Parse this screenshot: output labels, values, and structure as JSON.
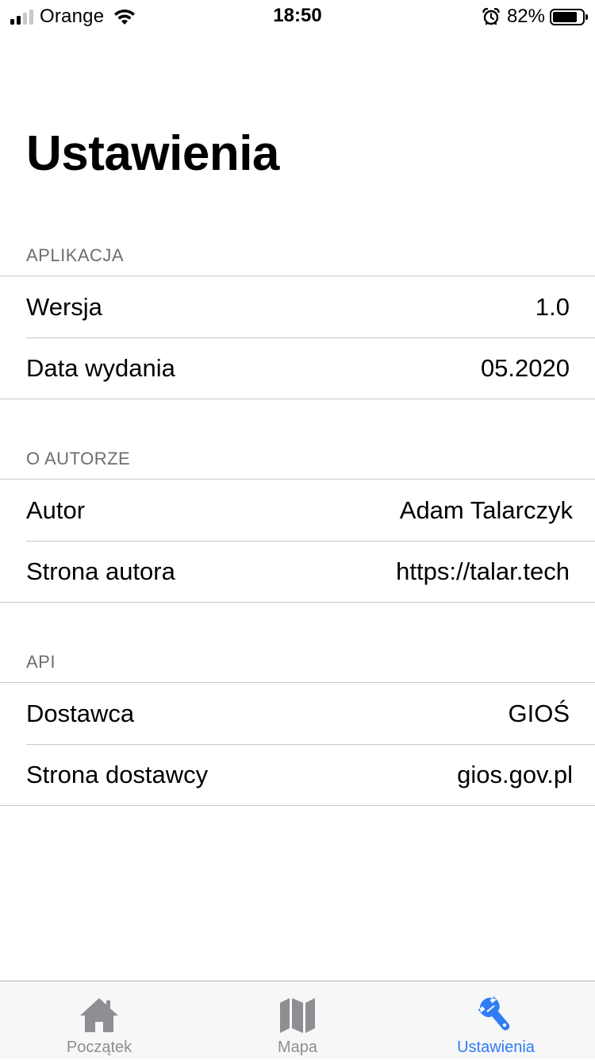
{
  "status_bar": {
    "carrier": "Orange",
    "time": "18:50",
    "battery_percent": "82%",
    "battery_level": 0.82,
    "signal_bars_active": 2,
    "signal_bars_total": 4,
    "icons": [
      "signal-icon",
      "wifi-icon",
      "alarm-icon",
      "battery-icon"
    ]
  },
  "page": {
    "title": "Ustawienia"
  },
  "sections": [
    {
      "header": "APLIKACJA",
      "rows": [
        {
          "label": "Wersja",
          "value": "1.0"
        },
        {
          "label": "Data wydania",
          "value": "05.2020"
        }
      ]
    },
    {
      "header": "O AUTORZE",
      "rows": [
        {
          "label": "Autor",
          "value": "Adam Talarczyk"
        },
        {
          "label": "Strona autora",
          "value": "https://talar.tech"
        }
      ]
    },
    {
      "header": "API",
      "rows": [
        {
          "label": "Dostawca",
          "value": "GIOŚ"
        },
        {
          "label": "Strona dostawcy",
          "value": "gios.gov.pl"
        }
      ]
    }
  ],
  "tab_bar": {
    "tabs": [
      {
        "label": "Początek",
        "icon": "house-icon",
        "active": false
      },
      {
        "label": "Mapa",
        "icon": "map-icon",
        "active": false
      },
      {
        "label": "Ustawienia",
        "icon": "wrench-icon",
        "active": true
      }
    ],
    "colors": {
      "active": "#2f7cf6",
      "inactive": "#8e8e93"
    }
  }
}
